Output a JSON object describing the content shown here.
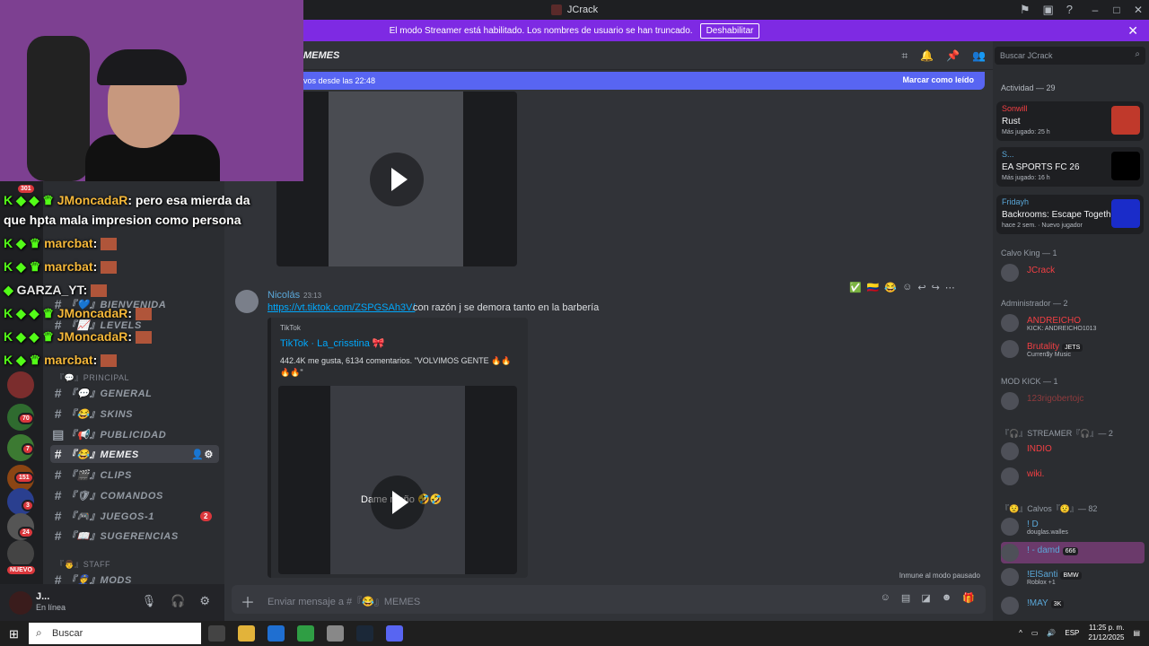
{
  "window": {
    "title": "JCrack"
  },
  "banner": {
    "text": "El modo Streamer está habilitado. Los nombres de usuario se han truncado.",
    "button": "Deshabilitar"
  },
  "server_badges": [
    "301",
    "70",
    "7",
    "151",
    "3",
    "24",
    "NUEVO"
  ],
  "channels": [
    {
      "label": "『💬』GENERAL",
      "badge": ""
    },
    {
      "label": "『😂』SKINS",
      "badge": ""
    },
    {
      "label": "『📢』PUBLICIDAD",
      "badge": ""
    },
    {
      "label": "『😂』MEMES",
      "badge": ""
    },
    {
      "label": "『🎬』CLIPS",
      "badge": ""
    },
    {
      "label": "『🛡』COMANDOS",
      "badge": ""
    },
    {
      "label": "『🎮』JUEGOS-1",
      "badge": "2"
    },
    {
      "label": "『📖』SUGERENCIAS",
      "badge": ""
    }
  ],
  "sidebar_partial": {
    "bienvenida": "『💙』BIENVENIDA",
    "levels": "『📈』LEVELS",
    "principal": "『💬』PRINCIPAL",
    "staff": "『👨』STAFF",
    "mods": "『👮』MODS"
  },
  "user": {
    "name": "J...",
    "status": "En línea"
  },
  "header": {
    "channel": "MEMES",
    "search_placeholder": "Buscar JCrack"
  },
  "newbar": {
    "left": "vos desde las 22:48",
    "right": "Marcar como leído"
  },
  "message": {
    "author": "Nicolás",
    "time": "23:13",
    "link": "https://vt.tiktok.com/ZSPGSAh3V/",
    "text": "con razón j se demora tanto en la barbería",
    "embed": {
      "provider": "TikTok",
      "title": "TikTok · La_crisstina 🎀",
      "description": "442.4K me gusta, 6134 comentarios. \"VOLVIMOS GENTE 🔥🔥🔥🔥\"",
      "overlay": "Dame moño 🤣🤣"
    }
  },
  "pause_note": "Inmune al modo pausado",
  "composer": {
    "placeholder": "Enviar mensaje a #『😂』MEMES"
  },
  "members": {
    "activity_header": "Actividad — 29",
    "activities": [
      {
        "player": "Sonwill",
        "game": "Rust",
        "detail": "Más jugado: 25 h",
        "color": "#c0392b"
      },
      {
        "player": "S...",
        "game": "EA SPORTS FC 26",
        "detail": "Más jugado: 16 h",
        "color": "#000000"
      },
      {
        "player": "Fridayh",
        "game": "Backrooms: Escape Together",
        "detail": "hace 2 sem. · Nuevo jugador",
        "color": "#1a2cc9"
      }
    ],
    "groups": [
      {
        "title": "Calvo King — 1"
      },
      {
        "title": "Administrador — 2"
      },
      {
        "title": "MOD KICK — 1"
      },
      {
        "title": "『🎧』STREAMER『🎧』— 2"
      },
      {
        "title": "『😟』Calvos『😟』— 82"
      }
    ],
    "list": [
      {
        "name": "JCrack",
        "sub": "",
        "tag": "",
        "color": "#f23f43"
      },
      {
        "name": "ANDREICHO",
        "sub": "KICK: ANDREICHO1013",
        "tag": "",
        "color": "#f23f43"
      },
      {
        "name": "Brutality",
        "sub": "Curren$y Music",
        "tag": "JETS",
        "color": "#f23f43"
      },
      {
        "name": "123rigobertojc",
        "sub": "",
        "tag": "",
        "color": "#f23f43"
      },
      {
        "name": "INDIO",
        "sub": "",
        "tag": "",
        "color": "#f23f43"
      },
      {
        "name": "wiki.",
        "sub": "",
        "tag": "",
        "color": "#f23f43"
      },
      {
        "name": "! D",
        "sub": "douglas.walles",
        "tag": "",
        "color": "#5aa7d8"
      },
      {
        "name": "! - damd",
        "sub": "",
        "tag": "666",
        "color": "#5aa7d8"
      },
      {
        "name": "!ElSanti",
        "sub": "Roblox +1",
        "tag": "BMW",
        "color": "#5aa7d8"
      },
      {
        "name": "!MAY",
        "sub": "",
        "tag": "3K",
        "color": "#5aa7d8"
      }
    ]
  },
  "stream_chat": [
    {
      "name": "JMoncadaR",
      "text": ": pero esa mierda da"
    },
    {
      "name": "",
      "text": "que hpta mala impresion como persona"
    },
    {
      "name": "marcbat",
      "text": ":"
    },
    {
      "name": "marcbat",
      "text": ":"
    },
    {
      "name": "GARZA_YT",
      "text": ":"
    },
    {
      "name": "JMoncadaR",
      "text": ":"
    },
    {
      "name": "JMoncadaR",
      "text": ":"
    },
    {
      "name": "marcbat",
      "text": ":"
    }
  ],
  "taskbar": {
    "search": "Buscar",
    "lang": "ESP",
    "time": "11:25 p. m.",
    "date": "21/12/2025"
  }
}
